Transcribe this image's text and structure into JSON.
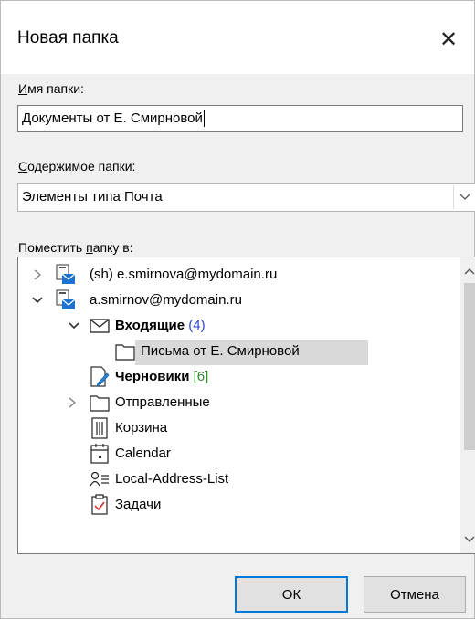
{
  "dialog": {
    "title": "Новая папка",
    "close_glyph": "✕",
    "name_label_underlined": "И",
    "name_label_rest": "мя папки:",
    "name_value": "Документы от Е. Смирновой",
    "contents_label_underlined": "С",
    "contents_label_rest": "одержимое папки:",
    "contents_value": "Элементы типа Почта",
    "place_label_prefix": "Поместить ",
    "place_label_underlined": "п",
    "place_label_rest": "апку в:",
    "ok_label": "ОК",
    "cancel_label": "Отмена"
  },
  "tree": {
    "account1": {
      "label": "(sh) e.smirnova@mydomain.ru",
      "icon": "mailbox-icon",
      "expanded": false
    },
    "account2": {
      "label": "a.smirnov@mydomain.ru",
      "icon": "mailbox-icon",
      "expanded": true
    },
    "inbox": {
      "label": "Входящие",
      "count": "(4)",
      "icon": "envelope-icon"
    },
    "subfolder": {
      "label": "Письма от Е. Смирновой",
      "icon": "folder-icon",
      "selected": true
    },
    "drafts": {
      "label": "Черновики",
      "count": "[6]",
      "icon": "drafts-icon"
    },
    "sent": {
      "label": "Отправленные",
      "icon": "folder-icon"
    },
    "trash": {
      "label": "Корзина",
      "icon": "trash-icon"
    },
    "calendar": {
      "label": "Calendar",
      "icon": "calendar-icon"
    },
    "addresslist": {
      "label": "Local-Address-List",
      "icon": "contacts-icon"
    },
    "tasks": {
      "label": "Задачи",
      "icon": "tasks-icon"
    }
  },
  "colors": {
    "count_blue": "#2b47c9",
    "count_green": "#2e8b2e",
    "accent": "#0078d7",
    "mailbox_blue": "#1e73d2"
  }
}
